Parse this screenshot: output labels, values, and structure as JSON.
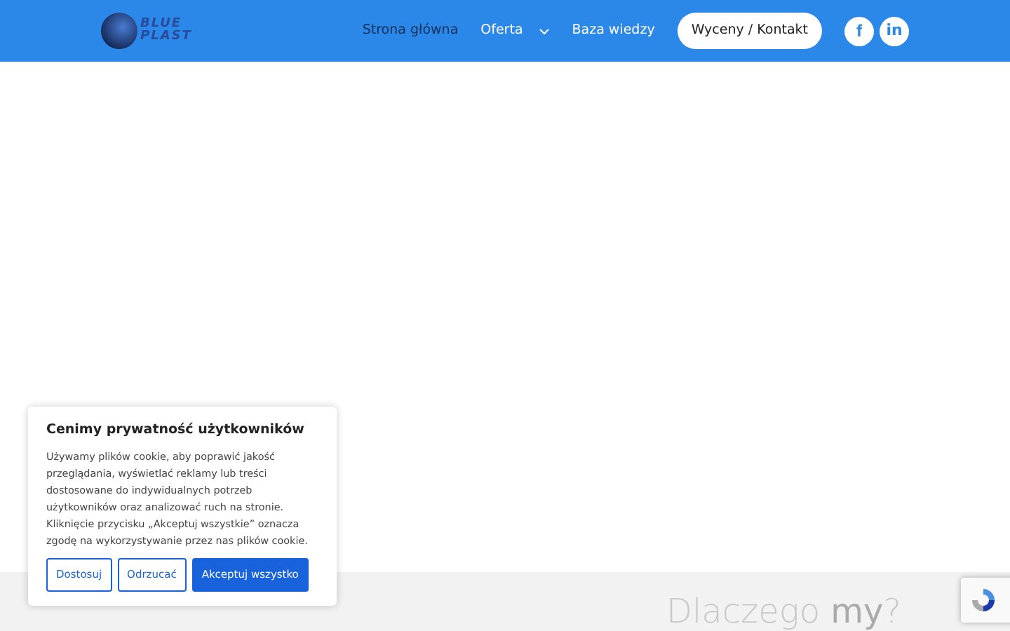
{
  "logo": {
    "lines": [
      "BLUE",
      "PLAST"
    ]
  },
  "nav": [
    {
      "label": "Strona główna",
      "selected": true,
      "dropdown": false
    },
    {
      "label": "Oferta",
      "selected": false,
      "dropdown": true
    },
    {
      "label": "Baza wiedzy",
      "selected": false,
      "dropdown": false
    }
  ],
  "cta": "Wyceny / Kontakt",
  "social": [
    {
      "kind": "facebook",
      "glyph": "f"
    },
    {
      "kind": "linkedin",
      "glyph": "in"
    }
  ],
  "section_heading": "Dlaczego **my**?",
  "cookie": {
    "title": "Cenimy prywatność użytkowników",
    "text": "Używamy plików cookie, aby poprawić jakość przeglądania, wyświetlać reklamy lub treści dostosowane do indywidualnych potrzeb użytkowników oraz analizować ruch na stronie. Kliknięcie przycisku „Akceptuj wszystkie” oznacza zgodę na wykorzystywanie przez nas plików cookie.",
    "buttons": [
      {
        "label": "Dostosuj",
        "kind": "outline"
      },
      {
        "label": "Odrzucać",
        "kind": "outline"
      },
      {
        "label": "Akceptuj wszystko",
        "kind": "primary"
      }
    ]
  }
}
